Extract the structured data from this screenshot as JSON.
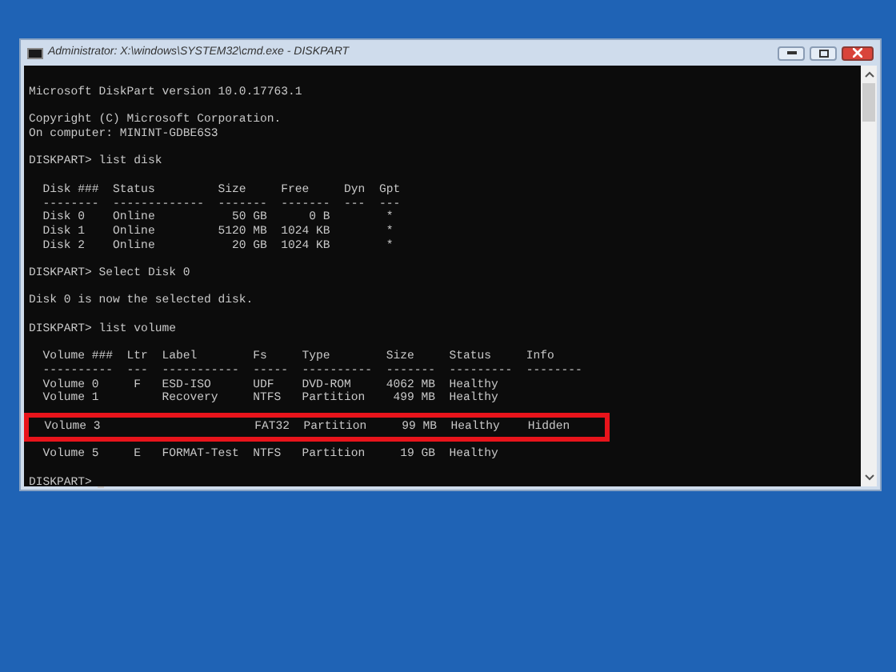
{
  "window": {
    "title": "Administrator: X:\\windows\\SYSTEM32\\cmd.exe - DISKPART"
  },
  "console": {
    "blocks": [
      {
        "lines": [
          {
            "text": "Microsoft DiskPart version 10.0.17763.1",
            "highlighted": false
          }
        ]
      },
      {
        "lines": [
          {
            "text": "Copyright (C) Microsoft Corporation.",
            "highlighted": false
          },
          {
            "text": "On computer: MININT-GDBE6S3",
            "highlighted": false
          }
        ]
      },
      {
        "lines": [
          {
            "text": "DISKPART> list disk",
            "highlighted": false
          }
        ]
      },
      {
        "lines": [
          {
            "text": "  Disk ###  Status         Size     Free     Dyn  Gpt",
            "highlighted": false
          },
          {
            "text": "  --------  -------------  -------  -------  ---  ---",
            "highlighted": false
          },
          {
            "text": "  Disk 0    Online           50 GB      0 B        *",
            "highlighted": false
          },
          {
            "text": "  Disk 1    Online         5120 MB  1024 KB        *",
            "highlighted": false
          },
          {
            "text": "  Disk 2    Online           20 GB  1024 KB        *",
            "highlighted": false
          }
        ]
      },
      {
        "lines": [
          {
            "text": "DISKPART> Select Disk 0",
            "highlighted": false
          }
        ]
      },
      {
        "lines": [
          {
            "text": "Disk 0 is now the selected disk.",
            "highlighted": false
          }
        ]
      },
      {
        "lines": [
          {
            "text": "DISKPART> list volume",
            "highlighted": false
          }
        ]
      },
      {
        "lines": [
          {
            "text": "  Volume ###  Ltr  Label        Fs     Type        Size     Status     Info",
            "highlighted": false
          },
          {
            "text": "  ----------  ---  -----------  -----  ----------  -------  ---------  --------",
            "highlighted": false
          },
          {
            "text": "  Volume 0     F   ESD-ISO      UDF    DVD-ROM     4062 MB  Healthy",
            "highlighted": false
          },
          {
            "text": "  Volume 1         Recovery     NTFS   Partition    499 MB  Healthy",
            "highlighted": false
          },
          {
            "text": "  Volume 3                      FAT32  Partition     99 MB  Healthy    Hidden",
            "highlighted": true
          },
          {
            "text": "  Volume 5     E   FORMAT-Test  NTFS   Partition     19 GB  Healthy",
            "highlighted": false
          }
        ]
      }
    ],
    "prompt": "DISKPART>"
  }
}
